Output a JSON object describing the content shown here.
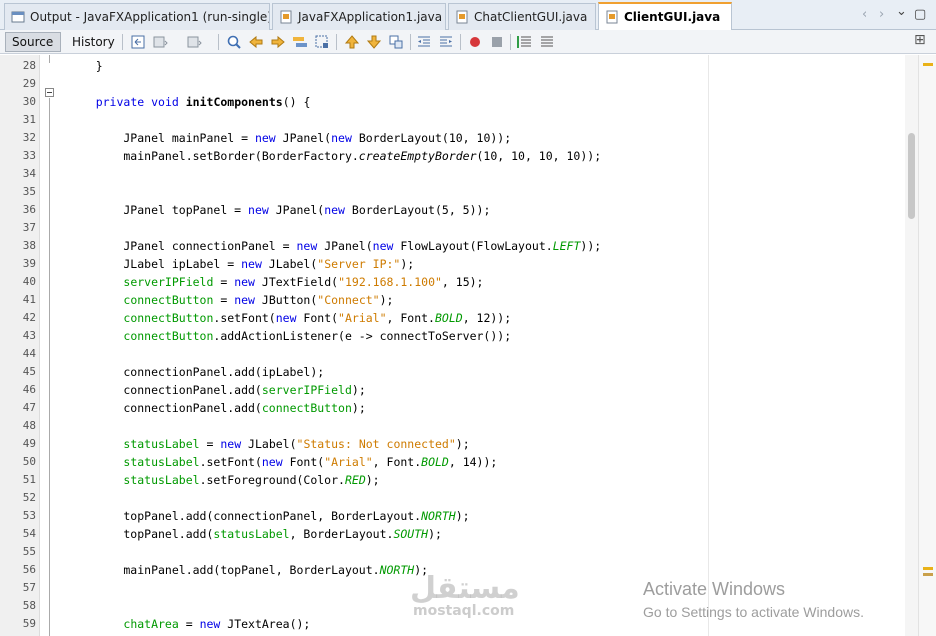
{
  "tabs": [
    {
      "label": "Output - JavaFXApplication1 (run-single)",
      "icon": "output-window-icon",
      "active": false
    },
    {
      "label": "JavaFXApplication1.java",
      "icon": "java-file-icon",
      "active": false
    },
    {
      "label": "ChatClientGUI.java",
      "icon": "java-file-icon",
      "active": false
    },
    {
      "label": "ClientGUI.java",
      "icon": "java-file-icon",
      "active": true
    }
  ],
  "tab_close_glyph": "×",
  "tab_nav": {
    "left": "‹",
    "right": "›",
    "dropdown": "⌄",
    "restore": "▢"
  },
  "toolbar": {
    "source_label": "Source",
    "history_label": "History",
    "expand_glyph": "⊞"
  },
  "editor": {
    "lines": [
      {
        "n": "28",
        "html": "    }"
      },
      {
        "n": "29",
        "html": ""
      },
      {
        "n": "30",
        "html": "    <span class=\"kw\">private</span> <span class=\"kw\">void</span> <span class=\"bold\">initComponents</span>() {"
      },
      {
        "n": "31",
        "html": ""
      },
      {
        "n": "32",
        "html": "        JPanel mainPanel = <span class=\"kw\">new</span> JPanel(<span class=\"kw\">new</span> BorderLayout(10, 10));"
      },
      {
        "n": "33",
        "html": "        mainPanel.setBorder(BorderFactory.<span class=\"it\">createEmptyBorder</span>(10, 10, 10, 10));"
      },
      {
        "n": "34",
        "html": ""
      },
      {
        "n": "35",
        "html": ""
      },
      {
        "n": "36",
        "html": "        JPanel topPanel = <span class=\"kw\">new</span> JPanel(<span class=\"kw\">new</span> BorderLayout(5, 5));"
      },
      {
        "n": "37",
        "html": ""
      },
      {
        "n": "38",
        "html": "        JPanel connectionPanel = <span class=\"kw\">new</span> JPanel(<span class=\"kw\">new</span> FlowLayout(FlowLayout.<span class=\"kcon\">LEFT</span>));"
      },
      {
        "n": "39",
        "html": "        JLabel ipLabel = <span class=\"kw\">new</span> JLabel(<span class=\"str\">\"Server IP:\"</span>);"
      },
      {
        "n": "40",
        "html": "        <span class=\"fld\">serverIPField</span> = <span class=\"kw\">new</span> JTextField(<span class=\"str\">\"192.168.1.100\"</span>, 15);"
      },
      {
        "n": "41",
        "html": "        <span class=\"fld\">connectButton</span> = <span class=\"kw\">new</span> JButton(<span class=\"str\">\"Connect\"</span>);"
      },
      {
        "n": "42",
        "html": "        <span class=\"fld\">connectButton</span>.setFont(<span class=\"kw\">new</span> Font(<span class=\"str\">\"Arial\"</span>, Font.<span class=\"kcon\">BOLD</span>, 12));"
      },
      {
        "n": "43",
        "html": "        <span class=\"fld\">connectButton</span>.addActionListener(e -&gt; connectToServer());"
      },
      {
        "n": "44",
        "html": ""
      },
      {
        "n": "45",
        "html": "        connectionPanel.add(ipLabel);"
      },
      {
        "n": "46",
        "html": "        connectionPanel.add(<span class=\"fld\">serverIPField</span>);"
      },
      {
        "n": "47",
        "html": "        connectionPanel.add(<span class=\"fld\">connectButton</span>);"
      },
      {
        "n": "48",
        "html": ""
      },
      {
        "n": "49",
        "html": "        <span class=\"fld\">statusLabel</span> = <span class=\"kw\">new</span> JLabel(<span class=\"str\">\"Status: Not connected\"</span>);"
      },
      {
        "n": "50",
        "html": "        <span class=\"fld\">statusLabel</span>.setFont(<span class=\"kw\">new</span> Font(<span class=\"str\">\"Arial\"</span>, Font.<span class=\"kcon\">BOLD</span>, 14));"
      },
      {
        "n": "51",
        "html": "        <span class=\"fld\">statusLabel</span>.setForeground(Color.<span class=\"kcon\">RED</span>);"
      },
      {
        "n": "52",
        "html": ""
      },
      {
        "n": "53",
        "html": "        topPanel.add(connectionPanel, BorderLayout.<span class=\"kcon\">NORTH</span>);"
      },
      {
        "n": "54",
        "html": "        topPanel.add(<span class=\"fld\">statusLabel</span>, BorderLayout.<span class=\"kcon\">SOUTH</span>);"
      },
      {
        "n": "55",
        "html": ""
      },
      {
        "n": "56",
        "html": "        mainPanel.add(topPanel, BorderLayout.<span class=\"kcon\">NORTH</span>);"
      },
      {
        "n": "57",
        "html": ""
      },
      {
        "n": "58",
        "html": ""
      },
      {
        "n": "59",
        "html": "        <span class=\"fld\">chatArea</span> = <span class=\"kw\">new</span> JTextArea();"
      }
    ]
  },
  "watermark": {
    "logo": "مستقل",
    "sub": "mostaql.com"
  },
  "activation": {
    "line1": "Activate Windows",
    "line2": "Go to Settings to activate Windows."
  },
  "colors": {
    "keyword": "#0000e6",
    "field": "#009900",
    "string": "#ce7b00",
    "active_tab_accent": "#f0a030",
    "error_stripe_mark": "#e9b218"
  }
}
